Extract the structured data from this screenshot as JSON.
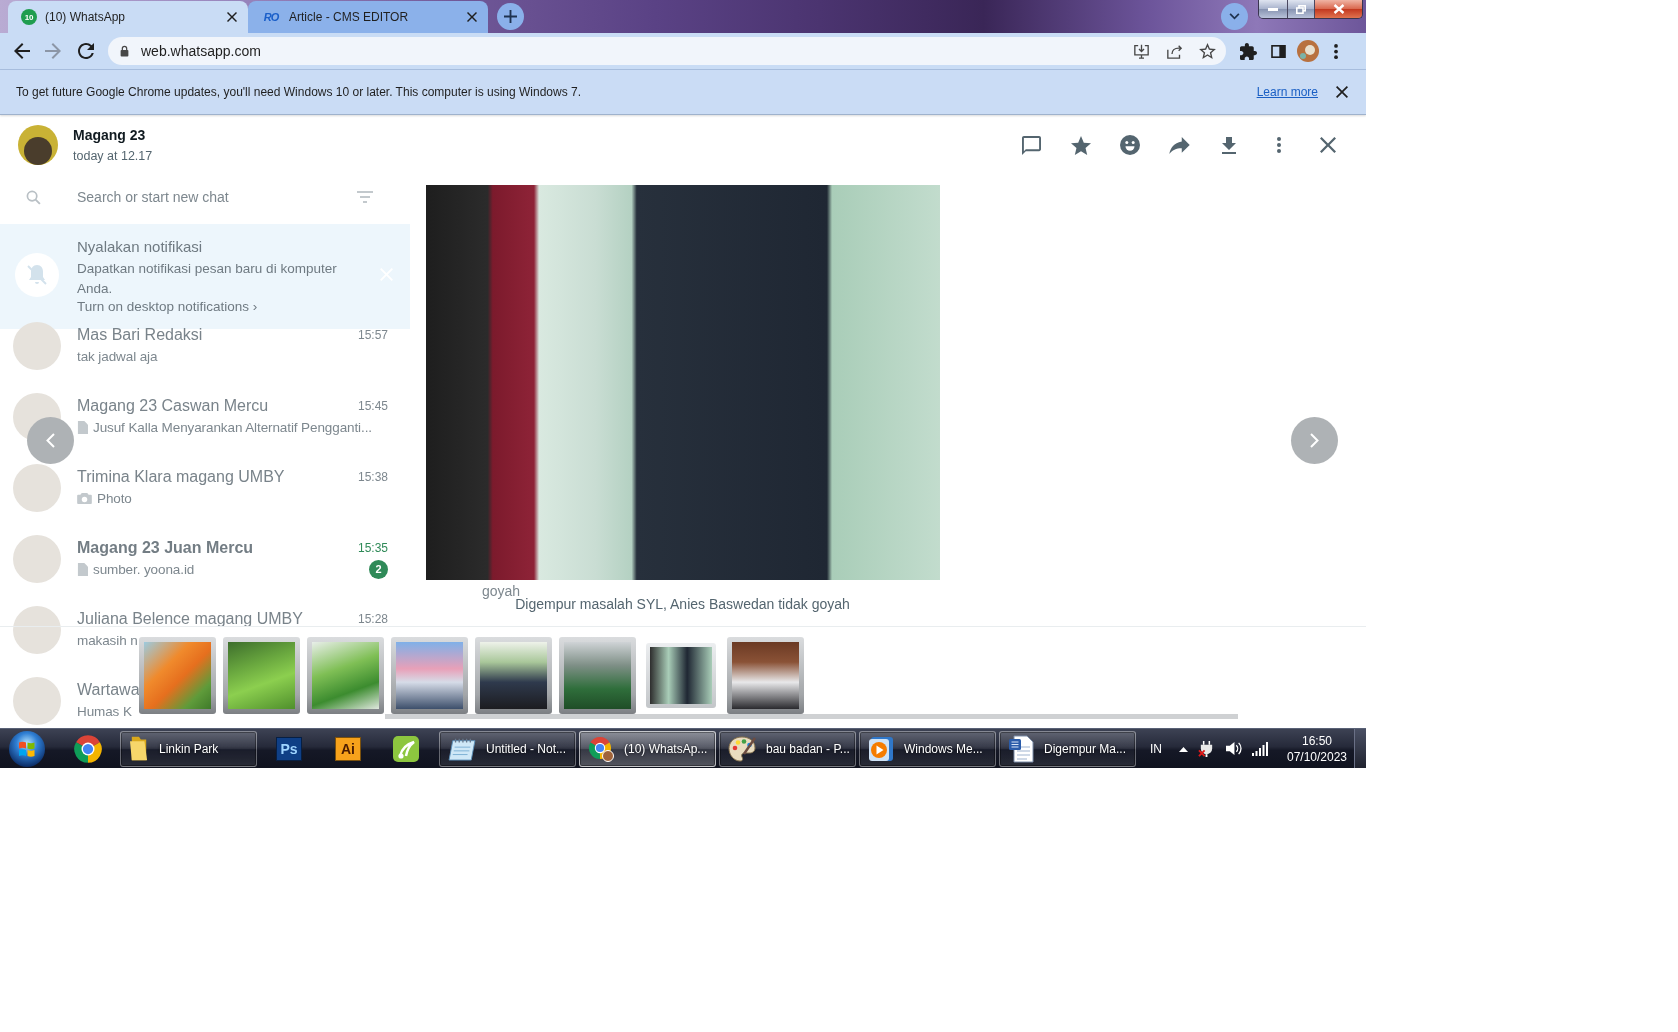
{
  "browser": {
    "tabs": [
      {
        "kind": "badge",
        "favicon_text": "10",
        "title": "(10) WhatsApp",
        "selected": true
      },
      {
        "kind": "wordmark",
        "favicon_text": "RO",
        "title": "Article - CMS EDITOR",
        "selected": false
      }
    ],
    "back": {
      "disabled": false
    },
    "forward": {
      "disabled": true
    },
    "address": "web.whatsapp.com"
  },
  "infobar": {
    "message": "To get future Google Chrome updates, you'll need Windows 10 or later. This computer is using Windows 7.",
    "link": "Learn more"
  },
  "background_app": {
    "search_placeholder": "Search or start new chat",
    "notice": {
      "title": "Nyalakan notifikasi",
      "body": "Dapatkan notifikasi pesan baru di komputer Anda.",
      "link": "Turn on desktop notifications ›"
    },
    "chats": [
      {
        "kind": "text",
        "name": "Mas Bari Redaksi",
        "time": "15:57",
        "preview": "tak jadwal aja"
      },
      {
        "kind": "file",
        "name": "Magang 23 Caswan Mercu",
        "time": "15:45",
        "preview": "Jusuf Kalla Menyarankan Alternatif Pengganti..."
      },
      {
        "kind": "photo",
        "name": "Trimina Klara magang UMBY",
        "time": "15:38",
        "preview": "Photo"
      },
      {
        "kind": "file",
        "name": "Magang 23 Juan Mercu",
        "time": "15:35",
        "preview": "sumber. yoona.id",
        "unread": "2"
      },
      {
        "kind": "text",
        "name": "Juliana Belence magang UMBY",
        "time": "15:28",
        "preview": "makasih n"
      },
      {
        "kind": "text",
        "name": "Wartawa",
        "preview": "Humas K"
      }
    ],
    "chat_text": "goyah"
  },
  "viewer": {
    "sender": "Magang 23",
    "time": "today at 12.17",
    "caption": "Digempur masalah SYL, Anies Baswedan tidak goyah",
    "thumbnails": [
      {
        "selected": false
      },
      {
        "selected": false
      },
      {
        "selected": false
      },
      {
        "selected": false
      },
      {
        "selected": false
      },
      {
        "selected": false
      },
      {
        "selected": true
      },
      {
        "selected": false
      }
    ]
  },
  "taskbar": {
    "items": [
      {
        "kind": "start"
      },
      {
        "kind": "pinned"
      },
      {
        "kind": "window",
        "label": "Linkin Park",
        "selected": false
      },
      {
        "kind": "tile",
        "label": "Ps",
        "color": "#0f3f86"
      },
      {
        "kind": "tile",
        "label": "Ai",
        "color": "#f7a21b"
      },
      {
        "kind": "pinned"
      },
      {
        "kind": "window",
        "label": "Untitled - Not...",
        "selected": false
      },
      {
        "kind": "window",
        "label": "(10) WhatsAp...",
        "selected": true
      },
      {
        "kind": "window",
        "label": "bau badan - P...",
        "selected": false
      },
      {
        "kind": "window",
        "label": "Windows Me...",
        "selected": false
      },
      {
        "kind": "window",
        "label": "Digempur Ma...",
        "selected": false
      }
    ],
    "language": "IN",
    "time": "16:50",
    "date": "07/10/2023"
  }
}
